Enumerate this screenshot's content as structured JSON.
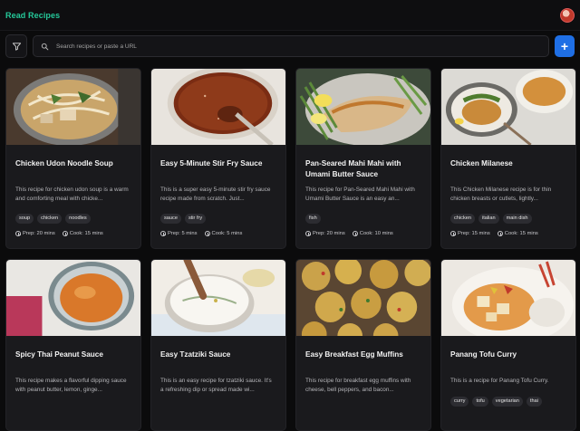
{
  "app": {
    "title": "Read Recipes"
  },
  "search": {
    "placeholder": "Search recipes or paste a URL"
  },
  "colors": {
    "accent": "#25c99a",
    "primary_button": "#1f6fe5",
    "background": "#0b0b0c",
    "card": "#1a1a1d"
  },
  "icons": {
    "filter": "filter-icon",
    "search": "search-icon",
    "add": "plus-icon",
    "time": "clock-icon"
  },
  "add_button": {
    "label": "+"
  },
  "recipes": [
    {
      "title": "Chicken Udon Noodle Soup",
      "desc": "This recipe for chicken udon soup is a warm and comforting meal with chicke...",
      "tags": [
        "soup",
        "chicken",
        "noodles"
      ],
      "prep": "Prep: 20 mins",
      "cook": "Cook: 15 mins"
    },
    {
      "title": "Easy 5-Minute Stir Fry Sauce",
      "desc": "This is a super easy 5-minute stir fry sauce recipe made from scratch. Just...",
      "tags": [
        "sauce",
        "stir fry"
      ],
      "prep": "Prep: 5 mins",
      "cook": "Cook: 5 mins"
    },
    {
      "title": "Pan-Seared Mahi Mahi with Umami Butter Sauce",
      "desc": "This recipe for Pan-Seared Mahi Mahi with Umami Butter Sauce is an easy an...",
      "tags": [
        "fish"
      ],
      "prep": "Prep: 20 mins",
      "cook": "Cook: 10 mins"
    },
    {
      "title": "Chicken Milanese",
      "desc": "This Chicken Milanese recipe is for thin chicken breasts or cutlets, lightly...",
      "tags": [
        "chicken",
        "italian",
        "main dish"
      ],
      "prep": "Prep: 15 mins",
      "cook": "Cook: 15 mins"
    },
    {
      "title": "Spicy Thai Peanut Sauce",
      "desc": "This recipe makes a flavorful dipping sauce with peanut butter, lemon, ginge...",
      "tags": [],
      "prep": "",
      "cook": ""
    },
    {
      "title": "Easy Tzatziki Sauce",
      "desc": "This is an easy recipe for tzatziki sauce. It's a refreshing dip or spread made wi...",
      "tags": [],
      "prep": "",
      "cook": ""
    },
    {
      "title": "Easy Breakfast Egg Muffins",
      "desc": "This recipe for breakfast egg muffins with cheese, bell peppers, and bacon...",
      "tags": [],
      "prep": "",
      "cook": ""
    },
    {
      "title": "Panang Tofu Curry",
      "desc": "This is a recipe for Panang Tofu Curry.",
      "tags": [
        "curry",
        "tofu",
        "vegetarian",
        "thai"
      ],
      "prep": "",
      "cook": ""
    }
  ]
}
